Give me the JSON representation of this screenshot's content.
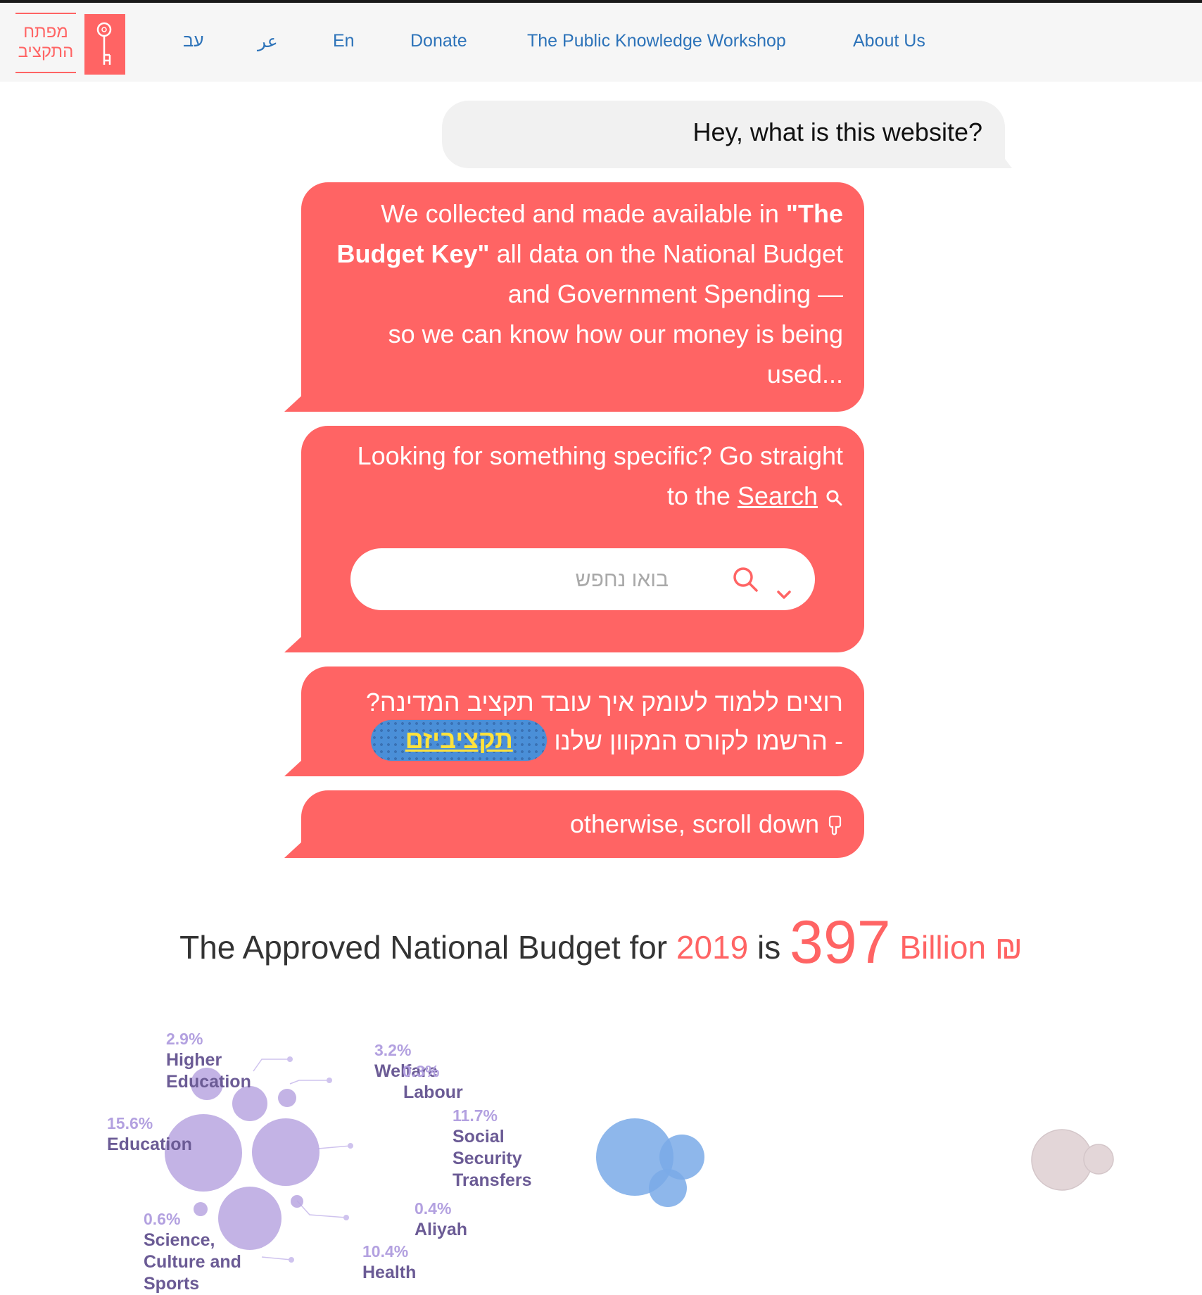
{
  "header": {
    "logo_text": "מפתח התקציב",
    "nav": [
      {
        "label": "עב"
      },
      {
        "label": "عر"
      },
      {
        "label": "En"
      },
      {
        "label": "Donate"
      },
      {
        "label": "The Public Knowledge Workshop"
      },
      {
        "label": "About Us"
      }
    ]
  },
  "chat": {
    "question": "Hey, what is this website?",
    "intro": {
      "part1": "We collected and made available in ",
      "bold": "\"The Budget Key\"",
      "part2": " all data on the National Budget and Government Spending —",
      "part3": "so we can know how our money is being used..."
    },
    "search_prompt": {
      "line1": "Looking for something specific? Go straight",
      "prefix": "to the ",
      "link": "Search"
    },
    "search": {
      "placeholder": "בואו נחפש",
      "value": ""
    },
    "course": {
      "line1": "?רוצים ללמוד לעומק איך עובד תקציב המדינה",
      "line2": "הרשמו לקורס המקוון שלנו -",
      "pill": "תקציביזם"
    },
    "scroll": "otherwise, scroll down"
  },
  "budget": {
    "prefix": "The Approved National Budget for ",
    "year": "2019",
    "is": " is ",
    "amount": "397",
    "unit": "Billion ₪"
  },
  "categories": [
    {
      "pct": "2.9%",
      "name": "Higher Education"
    },
    {
      "pct": "15.6%",
      "name": "Education"
    },
    {
      "pct": "0.6%",
      "name": "Science, Culture and Sports"
    },
    {
      "pct": "3.2%",
      "name": "Welfare"
    },
    {
      "pct": "0.3%",
      "name": "Labour"
    },
    {
      "pct": "11.7%",
      "name": "Social Security Transfers"
    },
    {
      "pct": "0.4%",
      "name": "Aliyah"
    },
    {
      "pct": "10.4%",
      "name": "Health"
    }
  ],
  "colors": {
    "accent": "#ff6464",
    "nav_link": "#2d73b9",
    "bubble_purple": "#b8a6e0",
    "bubble_blue": "#7aaae8",
    "bubble_gray": "#e3d6d8",
    "course_pill": "#4a8fd8",
    "course_text": "#ffe23c"
  }
}
